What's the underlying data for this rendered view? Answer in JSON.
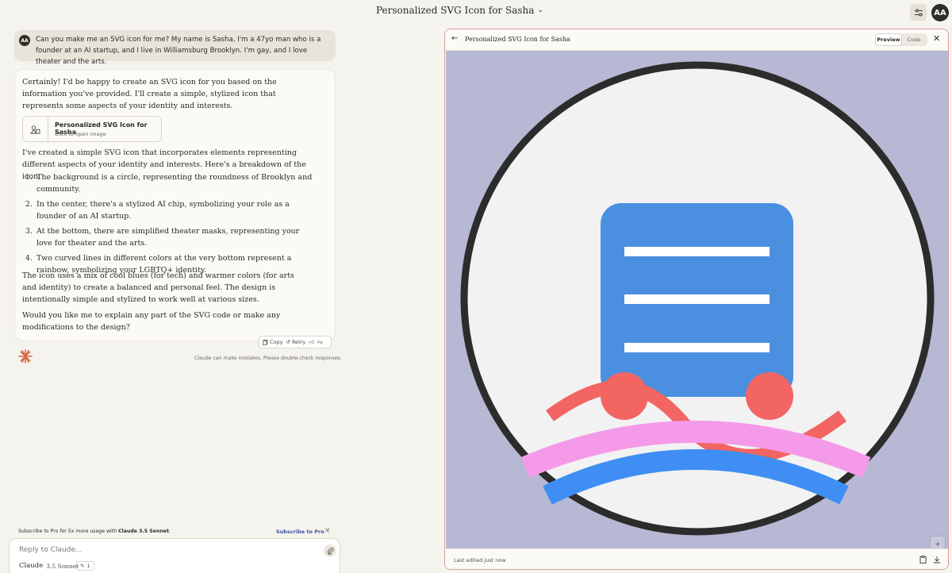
{
  "header": {
    "title": "Personalized SVG Icon for Sasha",
    "avatar_initials": "AA"
  },
  "user_message": {
    "avatar_initials": "AA",
    "text": "Can you make me an SVG icon for me? My name is Sasha, I'm a 47yo man who is a founder at an AI startup, and I live in Williamsburg Brooklyn. I'm gay, and I love theater and the arts."
  },
  "assistant_message": {
    "intro": "Certainly! I'd be happy to create an SVG icon for you based on the information you've provided. I'll create a simple, stylized icon that represents some aspects of your identity and interests.",
    "artifact_card": {
      "title": "Personalized SVG Icon for Sasha",
      "subtitle": "Click to open image"
    },
    "breakdown_intro": "I've created a simple SVG icon that incorporates elements representing different aspects of your identity and interests. Here's a breakdown of the icon:",
    "list": [
      {
        "num": "1.",
        "text": "The background is a circle, representing the roundness of Brooklyn and community."
      },
      {
        "num": "2.",
        "text": "In the center, there's a stylized AI chip, symbolizing your role as a founder of an AI startup."
      },
      {
        "num": "3.",
        "text": "At the bottom, there are simplified theater masks, representing your love for theater and the arts."
      },
      {
        "num": "4.",
        "text": "Two curved lines in different colors at the very bottom represent a rainbow, symbolizing your LGBTQ+ identity."
      }
    ],
    "colors_para": "The icon uses a mix of cool blues (for tech) and warmer colors (for arts and identity) to create a balanced and personal feel. The design is intentionally simple and stylized to work well at various sizes.",
    "closing": "Would you like me to explain any part of the SVG code or make any modifications to the design?",
    "actions": {
      "copy": "Copy",
      "retry": "Retry"
    }
  },
  "disclaimer": "Claude can make mistakes. Please double-check responses.",
  "promo": {
    "text_before": "Subscribe to Pro for 5x more usage with ",
    "text_bold": "Claude 3.5 Sonnet",
    "text_after": ".",
    "link": "Subscribe to Pro"
  },
  "composer": {
    "placeholder": "Reply to Claude...",
    "model_name": "Claude",
    "model_version": "3.5 Sonnet",
    "count": "1"
  },
  "artifact_panel": {
    "title": "Personalized SVG Icon for Sasha",
    "tabs": [
      {
        "label": "Preview",
        "active": true
      },
      {
        "label": "Code",
        "active": false
      }
    ],
    "footer_text": "Last edited just now",
    "zoom_in": "+",
    "zoom_out": "−"
  },
  "colors": {
    "canvas_bg": "#b7b8d3",
    "circle_fill": "#f2f2f2",
    "circle_stroke": "#2c2c2c",
    "chip": "#4a8fe0",
    "coral": "#f26563",
    "pink": "#f59ae9",
    "blue_arc": "#3f8ef3",
    "accent_border": "#d9a099"
  }
}
